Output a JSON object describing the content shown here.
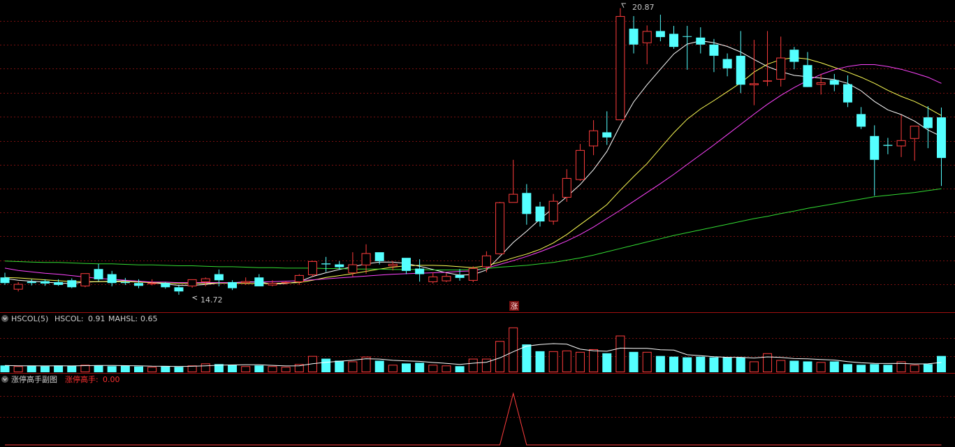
{
  "colors": {
    "background": "#000000",
    "grid": "#7a1010",
    "separator": "#a01010",
    "up": "#ff3d3d",
    "down": "#54ffff",
    "ma5": "#ffffff",
    "ma10": "#ffff55",
    "ma20": "#ff44ff",
    "ma60": "#33dd33",
    "header_text": "#d0d0d0",
    "header_red": "#ff3030"
  },
  "main_panel": {
    "high_label": "20.87",
    "low_label": "14.72",
    "signal_marker": "涨"
  },
  "volume_panel": {
    "title": "HSCOL(5)",
    "hscol_label": "HSCOL:",
    "hscol_value": "0.91",
    "mahsl_label": "MAHSL:",
    "mahsl_value": "0.65",
    "collapse_icon": "chevron-down-icon"
  },
  "signal_panel": {
    "title": "涨停高手副图",
    "indicator_label": "涨停高手:",
    "indicator_value": "0.00",
    "collapse_icon": "chevron-down-icon"
  },
  "chart_data": [
    {
      "type": "candlestick",
      "ylim": [
        14.4,
        21.0
      ],
      "high": 20.87,
      "low": 14.72,
      "ohlc": [
        [
          15.1,
          15.2,
          14.94,
          14.98
        ],
        [
          14.84,
          15.0,
          14.8,
          14.96
        ],
        [
          15.01,
          15.06,
          14.93,
          14.98
        ],
        [
          15.02,
          15.06,
          14.92,
          14.97
        ],
        [
          15.0,
          15.06,
          14.92,
          14.94
        ],
        [
          15.04,
          15.08,
          14.87,
          14.89
        ],
        [
          14.91,
          15.19,
          14.89,
          15.19
        ],
        [
          15.28,
          15.39,
          15.02,
          15.06
        ],
        [
          15.17,
          15.24,
          14.91,
          14.98
        ],
        [
          15.0,
          15.09,
          14.94,
          14.98
        ],
        [
          14.98,
          15.06,
          14.87,
          14.92
        ],
        [
          14.98,
          15.06,
          14.93,
          14.98
        ],
        [
          14.98,
          15.0,
          14.86,
          14.89
        ],
        [
          14.89,
          14.93,
          14.73,
          14.8
        ],
        [
          14.91,
          15.06,
          14.88,
          15.06
        ],
        [
          15.0,
          15.1,
          14.91,
          15.08
        ],
        [
          15.17,
          15.27,
          14.91,
          15.04
        ],
        [
          15.0,
          15.04,
          14.83,
          14.87
        ],
        [
          14.98,
          15.1,
          14.94,
          15.02
        ],
        [
          15.1,
          15.17,
          14.91,
          14.91
        ],
        [
          14.93,
          15.04,
          14.91,
          14.98
        ],
        [
          15.0,
          15.02,
          14.95,
          15.0
        ],
        [
          15.0,
          15.17,
          14.94,
          15.15
        ],
        [
          15.15,
          15.46,
          15.12,
          15.45
        ],
        [
          15.4,
          15.54,
          15.22,
          15.38
        ],
        [
          15.38,
          15.45,
          15.26,
          15.32
        ],
        [
          15.19,
          15.64,
          15.12,
          15.38
        ],
        [
          15.36,
          15.81,
          15.18,
          15.62
        ],
        [
          15.64,
          15.64,
          15.38,
          15.45
        ],
        [
          15.34,
          15.45,
          15.25,
          15.39
        ],
        [
          15.52,
          15.52,
          15.17,
          15.24
        ],
        [
          15.29,
          15.49,
          15.01,
          15.17
        ],
        [
          15.0,
          15.21,
          14.97,
          15.12
        ],
        [
          15.02,
          15.19,
          15.0,
          15.13
        ],
        [
          15.15,
          15.28,
          15.03,
          15.09
        ],
        [
          15.03,
          15.34,
          15.0,
          15.3
        ],
        [
          15.32,
          15.66,
          15.21,
          15.57
        ],
        [
          15.6,
          16.72,
          15.59,
          16.71
        ],
        [
          16.7,
          17.62,
          16.7,
          16.89
        ],
        [
          16.91,
          17.1,
          16.23,
          16.46
        ],
        [
          16.62,
          16.72,
          16.19,
          16.3
        ],
        [
          16.3,
          16.89,
          16.23,
          16.74
        ],
        [
          16.81,
          17.42,
          16.72,
          17.23
        ],
        [
          17.19,
          17.96,
          17.17,
          17.83
        ],
        [
          17.91,
          18.47,
          17.72,
          18.25
        ],
        [
          18.21,
          18.66,
          17.94,
          18.1
        ],
        [
          18.47,
          20.87,
          18.47,
          20.7
        ],
        [
          20.43,
          20.7,
          19.9,
          20.09
        ],
        [
          20.12,
          20.5,
          19.67,
          20.38
        ],
        [
          20.38,
          20.73,
          20.16,
          20.25
        ],
        [
          20.32,
          20.49,
          20.0,
          20.04
        ],
        [
          20.27,
          20.49,
          19.55,
          20.26
        ],
        [
          20.24,
          20.46,
          19.9,
          20.09
        ],
        [
          20.09,
          20.21,
          19.5,
          19.85
        ],
        [
          19.78,
          19.9,
          19.41,
          19.58
        ],
        [
          19.85,
          20.38,
          19.05,
          19.23
        ],
        [
          19.22,
          20.19,
          18.79,
          19.26
        ],
        [
          19.32,
          20.38,
          19.2,
          19.32
        ],
        [
          19.34,
          20.26,
          19.19,
          19.81
        ],
        [
          19.98,
          20.04,
          19.56,
          19.72
        ],
        [
          19.65,
          19.93,
          19.19,
          19.18
        ],
        [
          19.23,
          19.46,
          19.02,
          19.28
        ],
        [
          19.33,
          19.46,
          19.09,
          19.23
        ],
        [
          19.24,
          19.43,
          18.75,
          18.85
        ],
        [
          18.6,
          18.75,
          18.28,
          18.33
        ],
        [
          18.13,
          18.36,
          16.85,
          17.62
        ],
        [
          17.94,
          18.09,
          17.74,
          17.92
        ],
        [
          17.91,
          18.58,
          17.68,
          18.04
        ],
        [
          18.07,
          18.28,
          17.6,
          18.35
        ],
        [
          18.53,
          18.77,
          17.87,
          18.3
        ],
        [
          18.53,
          18.74,
          17.06,
          17.66
        ]
      ],
      "series": [
        {
          "name": "MA5",
          "values": [
            15.08,
            15.04,
            15.02,
            15.0,
            14.98,
            14.97,
            15.0,
            15.01,
            15.02,
            15.03,
            15.02,
            14.99,
            14.96,
            14.93,
            14.93,
            14.95,
            14.98,
            14.98,
            15.01,
            15.0,
            14.96,
            14.97,
            15.01,
            15.12,
            15.2,
            15.27,
            15.33,
            15.39,
            15.43,
            15.43,
            15.4,
            15.34,
            15.27,
            15.2,
            15.15,
            15.16,
            15.26,
            15.55,
            15.85,
            16.09,
            16.35,
            16.59,
            16.83,
            17.09,
            17.41,
            17.8,
            18.36,
            18.86,
            19.23,
            19.56,
            19.89,
            20.1,
            20.17,
            20.13,
            20.05,
            19.93,
            19.77,
            19.62,
            19.51,
            19.43,
            19.4,
            19.37,
            19.34,
            19.26,
            19.1,
            18.87,
            18.69,
            18.59,
            18.45,
            18.26,
            18.12
          ]
        },
        {
          "name": "MA10",
          "values": [
            15.1,
            15.09,
            15.07,
            15.05,
            15.03,
            15.01,
            15.01,
            15.01,
            15.01,
            15.01,
            15.0,
            14.99,
            14.98,
            14.97,
            14.97,
            14.97,
            14.98,
            14.98,
            14.97,
            14.97,
            14.97,
            14.98,
            14.99,
            15.04,
            15.1,
            15.14,
            15.18,
            15.23,
            15.28,
            15.32,
            15.35,
            15.36,
            15.36,
            15.35,
            15.33,
            15.31,
            15.35,
            15.43,
            15.52,
            15.6,
            15.7,
            15.84,
            16.02,
            16.23,
            16.44,
            16.66,
            16.97,
            17.26,
            17.54,
            17.87,
            18.2,
            18.49,
            18.71,
            18.89,
            19.08,
            19.27,
            19.5,
            19.67,
            19.77,
            19.81,
            19.78,
            19.7,
            19.6,
            19.5,
            19.39,
            19.26,
            19.11,
            18.98,
            18.87,
            18.73,
            18.57
          ]
        },
        {
          "name": "MA20",
          "values": [
            15.3,
            15.25,
            15.22,
            15.19,
            15.17,
            15.14,
            15.11,
            15.08,
            15.06,
            15.04,
            15.02,
            15.0,
            15.0,
            14.99,
            14.99,
            14.99,
            14.99,
            14.99,
            15.0,
            15.0,
            15.01,
            15.02,
            15.03,
            15.05,
            15.07,
            15.09,
            15.11,
            15.13,
            15.15,
            15.17,
            15.18,
            15.19,
            15.2,
            15.21,
            15.23,
            15.24,
            15.3,
            15.38,
            15.46,
            15.55,
            15.65,
            15.76,
            15.88,
            16.02,
            16.18,
            16.36,
            16.54,
            16.73,
            16.92,
            17.11,
            17.31,
            17.52,
            17.73,
            17.94,
            18.16,
            18.38,
            18.6,
            18.81,
            19.0,
            19.17,
            19.32,
            19.45,
            19.55,
            19.62,
            19.66,
            19.66,
            19.62,
            19.56,
            19.48,
            19.39,
            19.26
          ]
        },
        {
          "name": "MA60",
          "values": [
            15.45,
            15.44,
            15.43,
            15.42,
            15.42,
            15.41,
            15.4,
            15.39,
            15.39,
            15.38,
            15.37,
            15.37,
            15.36,
            15.35,
            15.35,
            15.34,
            15.33,
            15.33,
            15.32,
            15.31,
            15.31,
            15.3,
            15.3,
            15.3,
            15.29,
            15.29,
            15.28,
            15.28,
            15.28,
            15.27,
            15.27,
            15.27,
            15.26,
            15.26,
            15.26,
            15.27,
            15.29,
            15.32,
            15.34,
            15.36,
            15.39,
            15.42,
            15.47,
            15.52,
            15.58,
            15.65,
            15.72,
            15.79,
            15.86,
            15.93,
            16.0,
            16.06,
            16.12,
            16.18,
            16.24,
            16.3,
            16.36,
            16.41,
            16.47,
            16.52,
            16.58,
            16.63,
            16.68,
            16.73,
            16.78,
            16.83,
            16.86,
            16.89,
            16.92,
            16.96,
            17.0
          ]
        }
      ]
    },
    {
      "type": "bar",
      "name": "HSCOL",
      "values": [
        0.5,
        0.45,
        0.48,
        0.45,
        0.5,
        0.48,
        0.55,
        0.5,
        0.45,
        0.48,
        0.43,
        0.4,
        0.45,
        0.4,
        0.5,
        0.65,
        0.6,
        0.55,
        0.45,
        0.5,
        0.45,
        0.4,
        0.6,
        1.2,
        1.0,
        0.85,
        0.8,
        1.15,
        0.85,
        0.55,
        0.65,
        0.7,
        0.55,
        0.5,
        0.45,
        1.0,
        1.0,
        2.3,
        3.3,
        2.05,
        1.55,
        1.55,
        1.6,
        1.5,
        1.7,
        1.4,
        2.7,
        1.5,
        1.5,
        1.2,
        1.15,
        1.1,
        1.15,
        1.1,
        1.1,
        1.1,
        0.8,
        1.4,
        0.9,
        0.85,
        0.8,
        0.75,
        0.8,
        0.6,
        0.55,
        0.6,
        0.55,
        0.8,
        0.55,
        0.6,
        1.2
      ],
      "series": [
        {
          "name": "MAHSL",
          "values": [
            0.5,
            0.48,
            0.48,
            0.47,
            0.48,
            0.47,
            0.49,
            0.5,
            0.5,
            0.49,
            0.48,
            0.45,
            0.44,
            0.42,
            0.44,
            0.48,
            0.52,
            0.54,
            0.55,
            0.55,
            0.51,
            0.47,
            0.48,
            0.63,
            0.73,
            0.81,
            0.89,
            1.0,
            0.97,
            0.88,
            0.84,
            0.8,
            0.72,
            0.66,
            0.58,
            0.67,
            0.74,
            1.06,
            1.51,
            1.93,
            2.04,
            2.11,
            2.07,
            1.7,
            1.58,
            1.55,
            1.78,
            1.76,
            1.76,
            1.66,
            1.63,
            1.29,
            1.22,
            1.14,
            1.1,
            1.1,
            1.05,
            1.13,
            1.09,
            1.01,
            0.99,
            0.94,
            0.9,
            0.78,
            0.7,
            0.66,
            0.65,
            0.66,
            0.61,
            0.62,
            0.72
          ]
        }
      ],
      "ylim": [
        0,
        3.6
      ]
    },
    {
      "type": "line",
      "name": "涨停高手",
      "values": [
        0,
        0,
        0,
        0,
        0,
        0,
        0,
        0,
        0,
        0,
        0,
        0,
        0,
        0,
        0,
        0,
        0,
        0,
        0,
        0,
        0,
        0,
        0,
        0,
        0,
        0,
        0,
        0,
        0,
        0,
        0,
        0,
        0,
        0,
        0,
        0,
        0,
        0,
        1,
        0,
        0,
        0,
        0,
        0,
        0,
        0,
        0,
        0,
        0,
        0,
        0,
        0,
        0,
        0,
        0,
        0,
        0,
        0,
        0,
        0,
        0,
        0,
        0,
        0,
        0,
        0,
        0,
        0,
        0,
        0,
        0
      ],
      "ylim": [
        0,
        1.1
      ]
    }
  ]
}
